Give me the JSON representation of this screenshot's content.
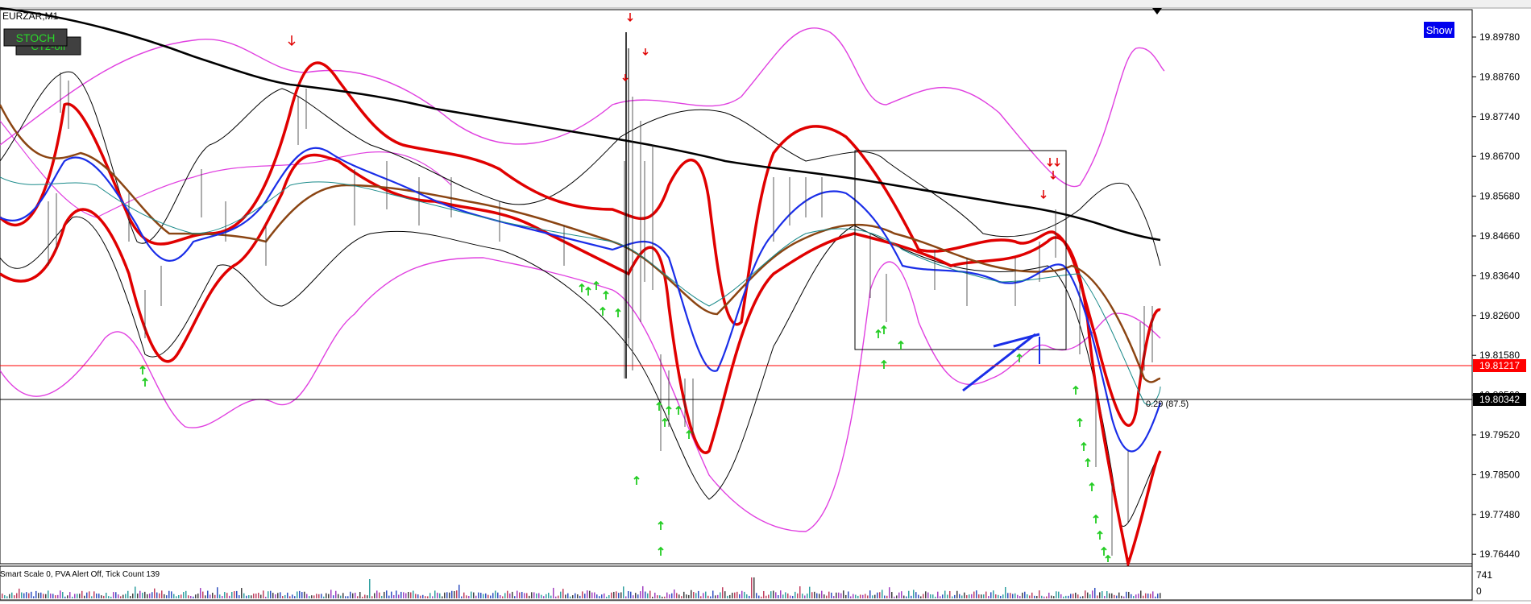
{
  "window": {
    "symbol_label": "EURZAR,M1"
  },
  "buttons": {
    "stoch": "STOCH",
    "ct2": "CT2-off",
    "show": "Show"
  },
  "price_axis": {
    "ticks": [
      "19.89780",
      "19.88760",
      "19.87740",
      "19.86700",
      "19.85680",
      "19.84660",
      "19.83640",
      "19.82600",
      "19.81580",
      "19.80560",
      "19.79520",
      "19.78500",
      "19.77480",
      "19.76440"
    ],
    "current_price_red": "19.81217",
    "current_price_black": "19.80342",
    "colors": {
      "red_line": "#ff0000",
      "black_line": "#000000"
    }
  },
  "annotations": {
    "cursor_readout": "0.29 (87.5)"
  },
  "volume_panel": {
    "status_text": "Smart Scale 0,  PVA Alert Off,  Tick Count 139",
    "axis_max": "741",
    "axis_min": "0"
  },
  "colors": {
    "ma_black": "#000000",
    "ma_red": "#e00000",
    "ma_brown": "#8b4513",
    "ma_blue": "#1a2ee8",
    "envelope_magenta": "#e040e0",
    "up_arrow": "#22cc22",
    "down_arrow": "#e00000",
    "trend_line": "#1a2ee8"
  }
}
